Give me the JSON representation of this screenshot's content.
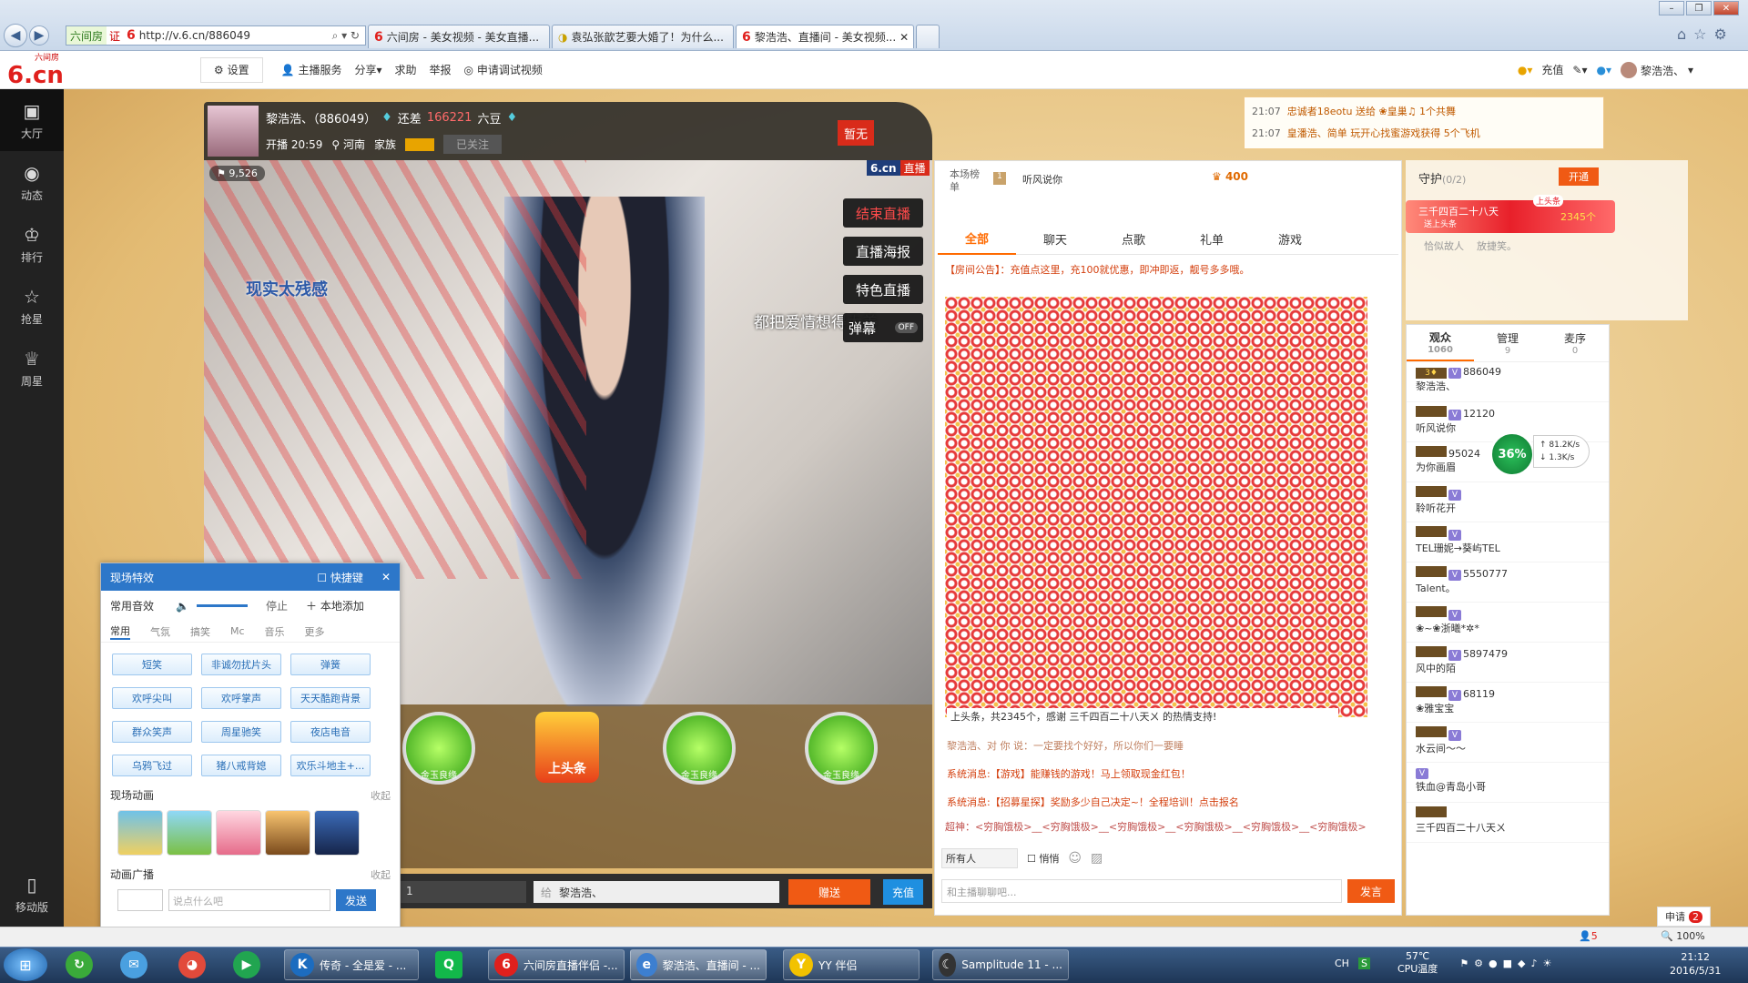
{
  "browser": {
    "address": "http://v.6.cn/886049",
    "prefix": "六间房",
    "prefix_tag": "证",
    "tabs": [
      "六间房 - 美女视频 - 美女直播...",
      "袁弘张歆艺要大婚了！为什么...",
      "黎浩浩、直播间 - 美女视频..."
    ]
  },
  "site": {
    "logo": "6.cn",
    "logo_sub": "六间房",
    "settings": "设置",
    "links": [
      "主播服务",
      "分享",
      "求助",
      "举报",
      "申请调试视频"
    ],
    "right": {
      "recharge": "充值",
      "username": "黎浩浩、"
    }
  },
  "leftnav": [
    {
      "icon": "tv-icon",
      "label": "大厅"
    },
    {
      "icon": "compass-icon",
      "label": "动态"
    },
    {
      "icon": "crown-icon",
      "label": "排行"
    },
    {
      "icon": "star-icon",
      "label": "抢星"
    },
    {
      "icon": "cup-icon",
      "label": "周星"
    }
  ],
  "leftnav_mobile": "移动版",
  "anchor": {
    "name": "黎浩浩、（886049）",
    "gap_label": "还差",
    "gap_value": "166221",
    "gap_unit": "六豆",
    "start": "开播 20:59",
    "location": "河南",
    "family": "家族",
    "follow": "已关注",
    "tag": "暂无",
    "viewers": "9,526"
  },
  "video": {
    "watermark": "6.cn",
    "live": "直播",
    "overlay_text": "现实太残感",
    "lyric": "都把爱情想得太美"
  },
  "overlay_buttons": [
    "结束直播",
    "直播海报",
    "特色直播",
    "弹幕"
  ],
  "danmu_state": "OFF",
  "gifts": [
    {
      "label": "金玉良缘"
    },
    {
      "label": "上头条",
      "featured": true
    },
    {
      "label": "金玉良缘"
    },
    {
      "label": "金玉良缘"
    }
  ],
  "sendbar": {
    "qty": "1",
    "to_prefix": "给",
    "to": "黎浩浩、",
    "send": "赠送",
    "recharge": "充值"
  },
  "chat": {
    "ranking": "本场榜单",
    "top_user": "听风说你",
    "top_score": "400",
    "tabs": [
      "全部",
      "聊天",
      "点歌",
      "礼单",
      "游戏"
    ],
    "notice": "【房间公告】：充值点这里，充100就优惠，即冲即返，靓号多多哦。",
    "headline": "上头条，共2345个，感谢 三千四百二十八天ㄨ 的热情支持!",
    "headline_user": "三千四百二十八天ㄨ",
    "messages": [
      "黎浩浩、对 你 说：一定要找个好好，所以你们一要睡",
      "系统消息:【游戏】能赚钱的游戏！马上领取现金红包！",
      "系统消息:【招募星探】奖励多少自己决定~！全程培训！点击报名"
    ],
    "broadcast": "超神：<穷胸饿极>__<穷胸饿极>__<穷胸饿极>__<穷胸饿极>__<穷胸饿极>__<穷胸饿极>",
    "to_all": "所有人",
    "whisper": "悄悄",
    "input_placeholder": "和主播聊聊吧...",
    "send": "发言"
  },
  "top_notice": [
    {
      "time": "21:07",
      "text": "忠诚者18eotu 送给 ❀皇巢♫ 1个共舞"
    },
    {
      "time": "21:07",
      "text": "皇潘浩、简单 玩开心找蜜游戏获得 5个飞机"
    }
  ],
  "guard": {
    "title": "守护",
    "count": "(0/2)",
    "open": "开通",
    "banner_user": "三千四百二十八天",
    "banner_sub": "送上头条",
    "banner_count": "2345个",
    "banner_tag": "上头条",
    "hint1": "恰似故人",
    "hint2": "放捷笑。"
  },
  "audience": {
    "tabs": [
      {
        "label": "观众",
        "count": "1060"
      },
      {
        "label": "管理",
        "count": "9"
      },
      {
        "label": "麦序",
        "count": "0"
      }
    ],
    "users": [
      {
        "id": "886049",
        "name": "黎浩浩、"
      },
      {
        "id": "12120",
        "name": "听风说你"
      },
      {
        "id": "95024",
        "name": "为你画眉"
      },
      {
        "id": "",
        "name": "聆听花开"
      },
      {
        "id": "",
        "name": "TEL珊妮→葵屿TEL"
      },
      {
        "id": "5550777",
        "name": "Talent。"
      },
      {
        "id": "",
        "name": "❀~❀浙曦*✲*"
      },
      {
        "id": "5897479",
        "name": "风中的陌"
      },
      {
        "id": "68119",
        "name": "❀雅宝宝"
      },
      {
        "id": "",
        "name": "水云间～～"
      },
      {
        "id": "",
        "name": "铁血@青岛小哥"
      },
      {
        "id": "",
        "name": "三千四百二十八天ㄨ"
      }
    ],
    "net": {
      "percent": "36%",
      "up": "81.2K/s",
      "down": "1.3K/s"
    },
    "apply": "申请",
    "apply_badge": "2"
  },
  "effects": {
    "title": "现场特效",
    "shortcut": "快捷键",
    "common_sound": "常用音效",
    "stop": "停止",
    "add_local": "本地添加",
    "tabs": [
      "常用",
      "气氛",
      "搞笑",
      "Mc",
      "音乐",
      "更多"
    ],
    "buttons": [
      "短笑",
      "非诚勿扰片头",
      "弹簧",
      "欢呼尖叫",
      "欢呼掌声",
      "天天酷跑背景",
      "群众笑声",
      "周星驰笑",
      "夜店电音",
      "乌鸦飞过",
      "猪八戒背媳",
      "欢乐斗地主+..."
    ],
    "anim_title": "现场动画",
    "collapse": "收起",
    "broadcast_title": "动画广播",
    "broadcast_placeholder": "说点什么吧",
    "send": "发送"
  },
  "status_bar": {
    "zoom": "100%",
    "count": "5"
  },
  "taskbar": {
    "items": [
      "传奇 - 全是爱 - ...",
      "六间房直播伴侣 -...",
      "黎浩浩、直播间 - ...",
      "YY 伴侣",
      "Samplitude 11 - ..."
    ],
    "tray": {
      "lang": "CH",
      "temp": "57℃",
      "cpu": "CPU温度",
      "time": "21:12",
      "date": "2016/5/31"
    }
  }
}
